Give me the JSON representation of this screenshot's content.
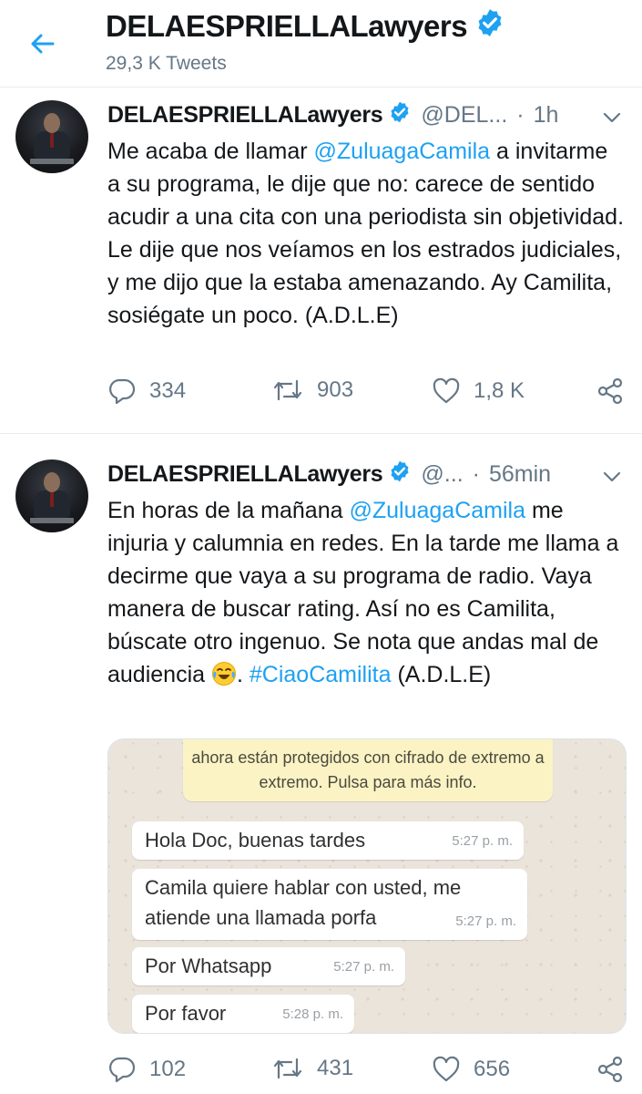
{
  "header": {
    "title": "DELAESPRIELLALawyers",
    "tweet_count": "29,3 K Tweets"
  },
  "colors": {
    "accent": "#1da1f2",
    "text": "#14171a",
    "muted": "#657786"
  },
  "tweets": [
    {
      "name": "DELAESPRIELLALawyers",
      "handle": "@DEL...",
      "dot": "·",
      "time": "1h",
      "text": {
        "p1": "Me acaba de llamar ",
        "mention": "@ZuluagaCamila",
        "p2": " a invitarme a su programa, le dije que no: carece de sentido acudir a una cita con una periodista sin objetividad. Le dije que nos veíamos en los estrados judiciales, y me dijo que la estaba amenazando. Ay Camilita, sosiégate un poco. (A.D.L.E)"
      },
      "replies": "334",
      "retweets": "903",
      "likes": "1,8 K"
    },
    {
      "name": "DELAESPRIELLALawyers",
      "handle": "@...",
      "dot": "·",
      "time": "56min",
      "text": {
        "p1": "En horas de la mañana ",
        "mention": "@ZuluagaCamila",
        "p2": " me injuria y calumnia en redes. En la tarde me llama a decirme que vaya a su programa de radio. Vaya manera de buscar rating. Así no es Camilita, búscate otro ingenuo. Se nota que andas mal de audiencia ",
        "p3": ". ",
        "hashtag": "#CiaoCamilita",
        "p4": " (A.D.L.E)"
      },
      "replies": "102",
      "retweets": "431",
      "likes": "656",
      "embed": {
        "system_message": "ahora están protegidos con cifrado de extremo a extremo. Pulsa para más info.",
        "messages": [
          {
            "text": "Hola Doc, buenas tardes",
            "time": "5:27 p. m."
          },
          {
            "text": "Camila quiere hablar con usted, me atiende una llamada porfa",
            "time": "5:27 p. m."
          },
          {
            "text": "Por Whatsapp",
            "time": "5:27 p. m."
          },
          {
            "text": "Por favor",
            "time": "5:28 p. m."
          }
        ]
      }
    }
  ],
  "icons": [
    "back-arrow-icon",
    "verified-badge-icon",
    "chevron-down-icon",
    "reply-icon",
    "retweet-icon",
    "like-icon",
    "share-icon",
    "laughing-tears-emoji-icon"
  ]
}
